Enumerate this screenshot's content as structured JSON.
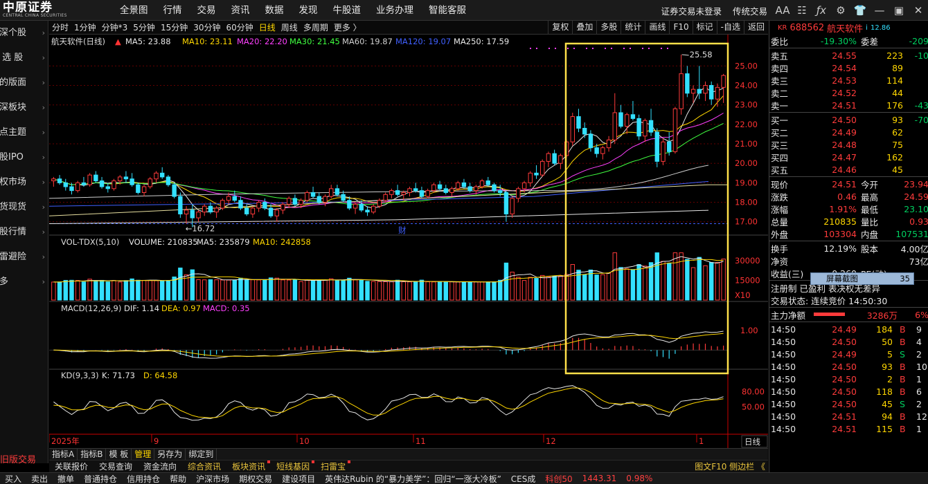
{
  "topbar": {
    "logo_cn": "中原证券",
    "logo_en": "CENTRAL CHINA SECURITIES",
    "menu": [
      "全景图",
      "行情",
      "交易",
      "资讯",
      "数据",
      "发现",
      "牛股道",
      "业务办理",
      "智能客服"
    ],
    "login_status": "证券交易未登录",
    "trade_link": "传统交易",
    "font_toggle": "AA"
  },
  "leftnav": {
    "items": [
      {
        "label": "沪深个股"
      },
      {
        "label": "自 选 股"
      },
      {
        "label": "我的版面"
      },
      {
        "label": "沪深板块"
      },
      {
        "label": "热点主题"
      },
      {
        "label": "新股IPO"
      },
      {
        "label": "期权市场"
      },
      {
        "label": "期货现货"
      },
      {
        "label": "港股行情"
      },
      {
        "label": "扫雷避险"
      },
      {
        "label": "更多"
      }
    ],
    "trade_labels": [
      "旧版交易",
      "买入"
    ]
  },
  "periods": [
    "分时",
    "1分钟",
    "分钟*3",
    "5分钟",
    "15分钟",
    "30分钟",
    "60分钟",
    "日线",
    "周线",
    "多周期",
    "更多 〉"
  ],
  "active_period": "日线",
  "chart_buttons": [
    "复权",
    "叠加",
    "多股",
    "统计",
    "画线",
    "F10",
    "标记",
    "-自选",
    "返回"
  ],
  "price_panel": {
    "stock_label": "航天软件(日线)",
    "ma5": "MA5: 23.88",
    "ma10": "MA10: 23.11",
    "ma20": "MA20: 22.20",
    "ma30": "MA30: 21.45",
    "ma60": "MA60: 19.87",
    "ma120": "MA120: 19.07",
    "ma250": "MA250: 17.59",
    "high_label": "25.58",
    "low_label": "16.72",
    "fin_marker": "财",
    "axis_ticks": [
      "25.00",
      "24.00",
      "23.00",
      "22.00",
      "21.00",
      "20.00",
      "19.00",
      "18.00",
      "17.00"
    ]
  },
  "vol_panel": {
    "title": "VOL-TDX(5,10)",
    "volume": "VOLUME: 210835",
    "ma5": "MA5: 235879",
    "ma10": "MA10: 242858",
    "axis_ticks": [
      "30000",
      "15000"
    ],
    "unit": "X10"
  },
  "macd_panel": {
    "title": "MACD(12,26,9)",
    "dif": "DIF: 1.14",
    "dea": "DEA: 0.97",
    "macd": "MACD: 0.35",
    "axis_ticks": [
      "1.00"
    ]
  },
  "kd_panel": {
    "title": "KD(9,3,3)",
    "k": "K: 71.73",
    "d": "D: 64.58",
    "axis_ticks": [
      "80.00",
      "50.00"
    ]
  },
  "timeline": {
    "labels": [
      "2025年",
      "9",
      "10",
      "11",
      "12",
      "1"
    ],
    "day_button": "日线"
  },
  "tabbar1": [
    "指标A",
    "指标B",
    "模 板",
    "管理",
    "另存为",
    "绑定到"
  ],
  "tabbar1_active": "管理",
  "tabbar2": [
    "关联报价",
    "交易查询",
    "资金流向",
    "综合资讯",
    "板块资讯",
    "短线基因",
    "扫雷宝"
  ],
  "fv_link": "图文F10 侧边栏 《",
  "status": [
    "买入",
    "卖出",
    "撤单",
    "普通持仓",
    "信用持仓",
    "帮助",
    "沪深市场",
    "期权交易",
    "建设项目",
    "英伟达Rubin 的“暴力美学”：回归“一涨大冷板”",
    "CES成",
    "科创50",
    "1443.31",
    "0.98%"
  ],
  "right": {
    "tag": "KR",
    "code": "688562",
    "name": "航天软件",
    "price_tag": "12.86",
    "weibi_label": "委比",
    "weibi": "-19.30%",
    "weicha_label": "委差",
    "weicha": "-209",
    "asks": [
      {
        "label": "卖五",
        "price": "24.55",
        "vol": "223",
        "chg": "-10"
      },
      {
        "label": "卖四",
        "price": "24.54",
        "vol": "89",
        "chg": ""
      },
      {
        "label": "卖三",
        "price": "24.53",
        "vol": "114",
        "chg": ""
      },
      {
        "label": "卖二",
        "price": "24.52",
        "vol": "44",
        "chg": ""
      },
      {
        "label": "卖一",
        "price": "24.51",
        "vol": "176",
        "chg": "-43"
      }
    ],
    "bids": [
      {
        "label": "买一",
        "price": "24.50",
        "vol": "93",
        "chg": "-70"
      },
      {
        "label": "买二",
        "price": "24.49",
        "vol": "62",
        "chg": ""
      },
      {
        "label": "买三",
        "price": "24.48",
        "vol": "75",
        "chg": ""
      },
      {
        "label": "买四",
        "price": "24.47",
        "vol": "162",
        "chg": ""
      },
      {
        "label": "买五",
        "price": "24.46",
        "vol": "45",
        "chg": ""
      }
    ],
    "stats": [
      {
        "l1": "现价",
        "v1": "24.51",
        "l2": "今开",
        "v2": "23.94"
      },
      {
        "l1": "涨跌",
        "v1": "0.46",
        "l2": "最高",
        "v2": "24.59"
      },
      {
        "l1": "涨幅",
        "v1": "1.91%",
        "l2": "最低",
        "v2": "23.10"
      },
      {
        "l1": "总量",
        "v1": "210835",
        "l2": "量比",
        "v2": "0.93"
      },
      {
        "l1": "外盘",
        "v1": "103304",
        "l2": "内盘",
        "v2": "107531"
      }
    ],
    "stats2": [
      {
        "l1": "换手",
        "v1": "12.19%",
        "l2": "股本",
        "v2": "4.00亿"
      },
      {
        "l1": "净资",
        "v1": "",
        "l2": "",
        "v2": "73亿"
      },
      {
        "l1": "收益(三)",
        "v1": "-0.260",
        "l2": "PE(动)",
        "v2": ""
      }
    ],
    "screenshot_tip": "屏幕截图",
    "screenshot_num": "35",
    "reg": "注册制 已盈利 表决权无差异",
    "trade_state": "交易状态: 连续竞价 14:50:30",
    "main_flow_label": "主力净额",
    "main_flow": "3286万",
    "main_flow_pct": "6%",
    "ticks": [
      {
        "t": "14:50",
        "p": "24.49",
        "v": "184",
        "d": "B",
        "x": "9"
      },
      {
        "t": "14:50",
        "p": "24.50",
        "v": "50",
        "d": "B",
        "x": "4"
      },
      {
        "t": "14:50",
        "p": "24.49",
        "v": "5",
        "d": "S",
        "x": "2"
      },
      {
        "t": "14:50",
        "p": "24.50",
        "v": "93",
        "d": "B",
        "x": "10"
      },
      {
        "t": "14:50",
        "p": "24.50",
        "v": "2",
        "d": "B",
        "x": "1"
      },
      {
        "t": "14:50",
        "p": "24.50",
        "v": "118",
        "d": "B",
        "x": "6"
      },
      {
        "t": "14:50",
        "p": "24.50",
        "v": "45",
        "d": "S",
        "x": "2"
      },
      {
        "t": "14:50",
        "p": "24.51",
        "v": "94",
        "d": "B",
        "x": "12"
      },
      {
        "t": "14:50",
        "p": "24.51",
        "v": "115",
        "d": "B",
        "x": "1"
      }
    ]
  },
  "chart_data": {
    "type": "candlestick",
    "title": "航天软件(日线)",
    "ylim": [
      16.6,
      25.9
    ],
    "high_label": 25.58,
    "low_label": 16.72,
    "candles": [
      [
        19.1,
        19.3,
        18.8,
        19.2
      ],
      [
        19.2,
        19.4,
        18.9,
        19.0
      ],
      [
        19.0,
        19.2,
        18.6,
        18.8
      ],
      [
        18.8,
        19.0,
        18.4,
        18.6
      ],
      [
        18.6,
        19.1,
        18.5,
        19.0
      ],
      [
        19.0,
        19.3,
        18.8,
        18.9
      ],
      [
        18.9,
        19.5,
        18.8,
        19.4
      ],
      [
        19.4,
        19.6,
        19.0,
        19.1
      ],
      [
        19.1,
        19.3,
        18.7,
        18.8
      ],
      [
        18.8,
        19.0,
        18.5,
        18.7
      ],
      [
        18.7,
        19.2,
        18.6,
        19.1
      ],
      [
        19.1,
        19.4,
        18.9,
        19.3
      ],
      [
        19.3,
        19.6,
        19.0,
        19.2
      ],
      [
        19.2,
        19.5,
        18.8,
        18.9
      ],
      [
        18.9,
        19.0,
        18.4,
        18.5
      ],
      [
        18.5,
        18.9,
        18.3,
        18.8
      ],
      [
        18.8,
        19.3,
        18.7,
        19.2
      ],
      [
        19.2,
        19.6,
        19.0,
        19.5
      ],
      [
        19.5,
        19.8,
        19.2,
        19.3
      ],
      [
        19.3,
        19.4,
        18.8,
        18.9
      ],
      [
        18.9,
        19.0,
        18.2,
        18.3
      ],
      [
        18.3,
        18.5,
        17.2,
        17.4
      ],
      [
        17.4,
        17.8,
        16.9,
        17.6
      ],
      [
        17.6,
        17.9,
        16.72,
        17.2
      ],
      [
        17.2,
        17.6,
        17.0,
        17.5
      ],
      [
        17.5,
        17.9,
        17.3,
        17.8
      ],
      [
        17.8,
        18.0,
        17.4,
        17.5
      ],
      [
        17.5,
        17.8,
        17.2,
        17.7
      ],
      [
        17.7,
        18.2,
        17.6,
        18.1
      ],
      [
        18.1,
        18.5,
        17.9,
        18.3
      ],
      [
        18.3,
        18.6,
        18.0,
        18.1
      ],
      [
        18.1,
        18.3,
        17.6,
        17.7
      ],
      [
        17.7,
        17.9,
        17.3,
        17.4
      ],
      [
        17.4,
        17.8,
        17.2,
        17.7
      ],
      [
        17.7,
        18.1,
        17.5,
        18.0
      ],
      [
        18.0,
        18.2,
        17.6,
        17.7
      ],
      [
        17.7,
        17.9,
        17.2,
        17.3
      ],
      [
        17.3,
        17.7,
        17.0,
        17.6
      ],
      [
        17.6,
        18.0,
        17.4,
        17.9
      ],
      [
        17.9,
        18.3,
        17.7,
        18.2
      ],
      [
        18.2,
        18.4,
        17.8,
        17.9
      ],
      [
        17.9,
        18.2,
        17.7,
        18.1
      ],
      [
        18.1,
        18.6,
        18.0,
        18.5
      ],
      [
        18.5,
        18.8,
        18.2,
        18.3
      ],
      [
        18.3,
        18.5,
        17.9,
        18.0
      ],
      [
        18.0,
        18.4,
        17.8,
        18.3
      ],
      [
        18.3,
        18.9,
        18.2,
        18.7
      ],
      [
        18.7,
        18.9,
        18.3,
        18.4
      ],
      [
        18.4,
        18.6,
        18.0,
        18.1
      ],
      [
        18.1,
        18.3,
        17.6,
        17.7
      ],
      [
        17.7,
        18.0,
        17.4,
        17.9
      ],
      [
        17.9,
        18.1,
        17.5,
        17.6
      ],
      [
        17.6,
        17.8,
        17.3,
        17.5
      ],
      [
        17.5,
        17.9,
        17.4,
        17.8
      ],
      [
        17.8,
        18.2,
        17.7,
        18.1
      ],
      [
        18.1,
        18.5,
        18.0,
        18.4
      ],
      [
        18.4,
        18.7,
        18.2,
        18.6
      ],
      [
        18.6,
        18.9,
        18.3,
        18.4
      ],
      [
        18.4,
        18.6,
        18.1,
        18.5
      ],
      [
        18.5,
        18.8,
        18.3,
        18.7
      ],
      [
        18.7,
        19.0,
        18.5,
        18.6
      ],
      [
        18.6,
        18.8,
        18.2,
        18.3
      ],
      [
        18.3,
        18.7,
        18.2,
        18.6
      ],
      [
        18.6,
        19.0,
        18.5,
        18.9
      ],
      [
        18.9,
        19.1,
        18.6,
        18.7
      ],
      [
        18.7,
        18.9,
        18.4,
        18.5
      ],
      [
        18.5,
        18.8,
        18.3,
        18.7
      ],
      [
        18.7,
        19.1,
        18.6,
        19.0
      ],
      [
        19.0,
        19.2,
        18.7,
        18.8
      ],
      [
        18.8,
        19.0,
        18.5,
        18.6
      ],
      [
        18.6,
        18.9,
        18.4,
        18.8
      ],
      [
        18.8,
        19.2,
        18.7,
        19.1
      ],
      [
        19.1,
        19.3,
        18.8,
        18.9
      ],
      [
        18.9,
        19.0,
        18.5,
        18.6
      ],
      [
        18.6,
        18.9,
        18.3,
        18.5
      ],
      [
        18.5,
        18.6,
        17.0,
        17.4
      ],
      [
        17.4,
        18.3,
        17.2,
        18.2
      ],
      [
        18.2,
        18.8,
        18.0,
        18.7
      ],
      [
        18.7,
        19.1,
        18.5,
        19.0
      ],
      [
        19.0,
        19.6,
        18.8,
        19.5
      ],
      [
        19.5,
        19.9,
        19.2,
        19.4
      ],
      [
        19.4,
        20.2,
        19.3,
        20.1
      ],
      [
        20.1,
        20.6,
        19.8,
        20.5
      ],
      [
        20.5,
        20.7,
        19.9,
        20.0
      ],
      [
        20.0,
        20.5,
        19.7,
        20.4
      ],
      [
        20.4,
        21.2,
        20.3,
        21.1
      ],
      [
        21.1,
        22.6,
        20.9,
        22.4
      ],
      [
        22.4,
        22.8,
        21.6,
        21.8
      ],
      [
        21.8,
        22.1,
        21.3,
        21.5
      ],
      [
        21.5,
        21.7,
        20.6,
        20.8
      ],
      [
        20.8,
        21.0,
        20.3,
        20.5
      ],
      [
        20.5,
        20.9,
        20.2,
        20.8
      ],
      [
        20.8,
        21.4,
        20.6,
        21.2
      ],
      [
        21.2,
        23.6,
        21.0,
        22.6
      ],
      [
        22.6,
        23.0,
        21.8,
        21.9
      ],
      [
        21.9,
        22.6,
        21.5,
        22.5
      ],
      [
        22.5,
        23.2,
        22.2,
        22.3
      ],
      [
        22.3,
        22.5,
        21.2,
        21.4
      ],
      [
        21.4,
        22.3,
        21.1,
        22.2
      ],
      [
        22.2,
        22.8,
        21.4,
        21.6
      ],
      [
        21.6,
        21.8,
        19.8,
        20.1
      ],
      [
        20.1,
        21.3,
        19.9,
        21.1
      ],
      [
        21.1,
        21.6,
        20.4,
        20.6
      ],
      [
        20.6,
        22.9,
        20.5,
        22.8
      ],
      [
        22.8,
        25.58,
        22.5,
        24.6
      ],
      [
        24.6,
        25.0,
        23.4,
        23.6
      ],
      [
        23.6,
        24.0,
        23.1,
        23.8
      ],
      [
        23.8,
        25.0,
        23.3,
        23.6
      ],
      [
        23.6,
        24.2,
        23.2,
        24.0
      ],
      [
        24.0,
        24.2,
        23.0,
        23.3
      ],
      [
        23.3,
        24.1,
        22.9,
        23.9
      ],
      [
        23.9,
        24.59,
        23.1,
        24.51
      ]
    ],
    "volume_ylim": [
      0,
      40000
    ],
    "macd_ylim": [
      -0.9,
      1.8
    ],
    "kd_ylim": [
      0,
      100
    ]
  }
}
